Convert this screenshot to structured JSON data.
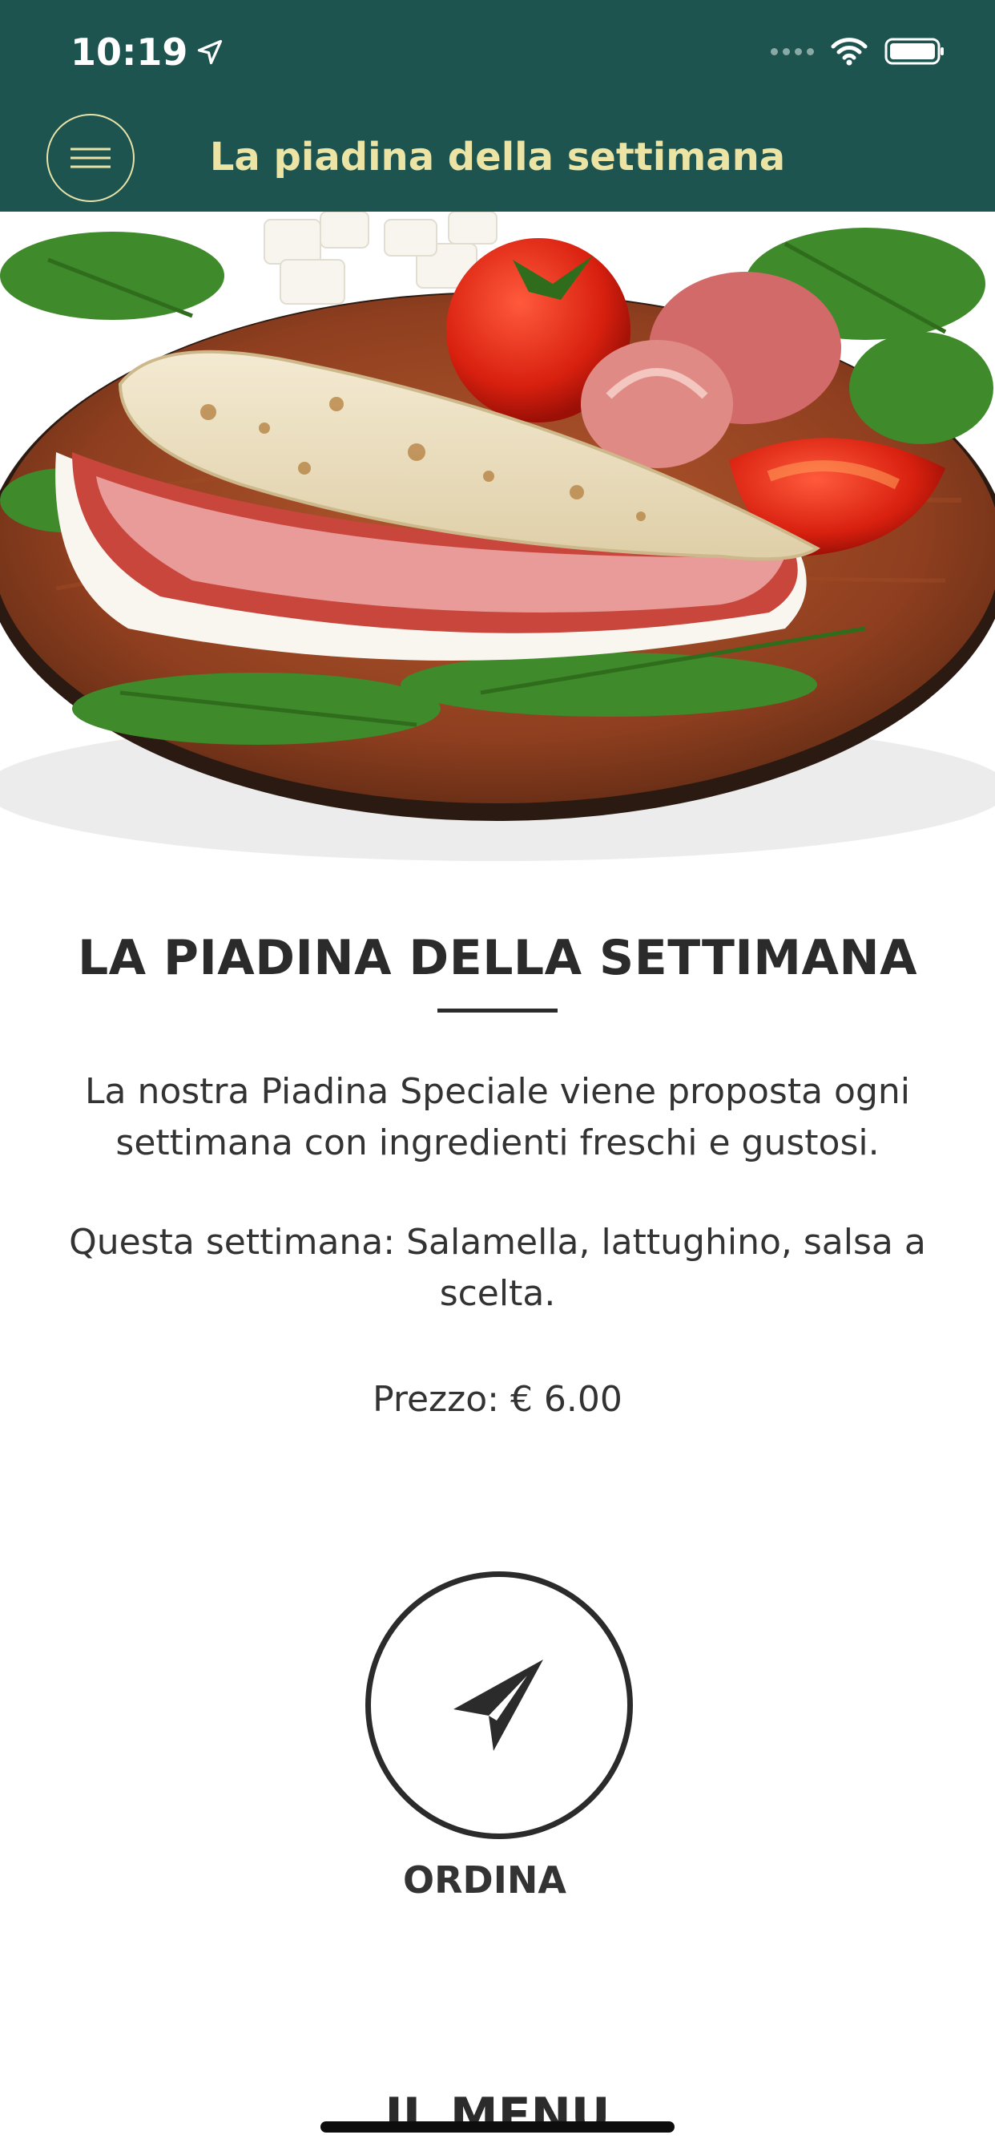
{
  "status_bar": {
    "time": "10:19",
    "icons": [
      "location-arrow-icon",
      "signal-icon",
      "wifi-icon",
      "battery-icon"
    ]
  },
  "header": {
    "title": "La piadina della settimana",
    "menu_icon": "hamburger-menu-icon",
    "colors": {
      "background": "#1d5450",
      "title": "#ece4a4"
    }
  },
  "hero": {
    "subject": "piadina-dish-image"
  },
  "content": {
    "title": "LA PIADINA DELLA SETTIMANA",
    "description": "La nostra Piadina Speciale viene proposta ogni settimana con ingredienti freschi e gustosi.",
    "weekly": "Questa settimana: Salamella, lattughino, salsa a scelta.",
    "price": "Prezzo: € 6.00"
  },
  "order": {
    "label": "ORDINA",
    "icon": "paper-plane-icon"
  },
  "next_section": {
    "title": "IL MENU"
  }
}
